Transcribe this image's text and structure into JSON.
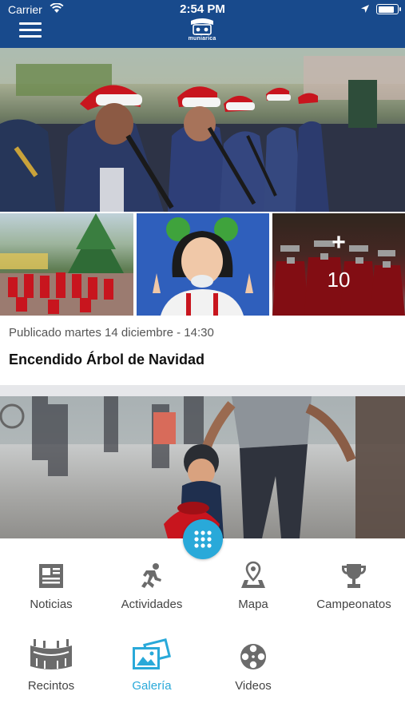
{
  "status_bar": {
    "carrier": "Carrier",
    "time": "2:54 PM"
  },
  "header": {
    "logo_text": "muniarica"
  },
  "gallery": {
    "more_plus": "+",
    "more_count": "10"
  },
  "post": {
    "date": "Publicado martes 14 diciembre - 14:30",
    "title": "Encendido Árbol de Navidad"
  },
  "menu": {
    "items": [
      {
        "label": "Noticias",
        "icon": "newspaper-icon"
      },
      {
        "label": "Actividades",
        "icon": "running-person-icon"
      },
      {
        "label": "Mapa",
        "icon": "map-pin-icon"
      },
      {
        "label": "Campeonatos",
        "icon": "trophy-icon"
      },
      {
        "label": "Recintos",
        "icon": "stadium-icon"
      },
      {
        "label": "Galería",
        "icon": "photo-gallery-icon",
        "active": true
      },
      {
        "label": "Videos",
        "icon": "film-reel-icon"
      }
    ]
  },
  "colors": {
    "primary": "#184a8c",
    "accent": "#29a9d9",
    "icon_gray": "#666666"
  }
}
